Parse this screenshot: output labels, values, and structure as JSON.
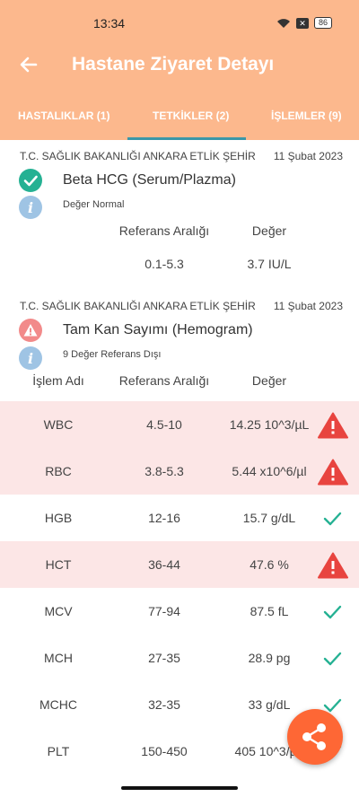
{
  "status_bar": {
    "time": "13:34",
    "battery": "86",
    "icons": [
      "wifi-icon",
      "x-box-icon",
      "battery-icon"
    ]
  },
  "app_bar": {
    "title": "Hastane Ziyaret Detayı",
    "back_icon": "arrow-left-icon"
  },
  "tabs": [
    {
      "label": "HASTALIKLAR (1)",
      "selected": false
    },
    {
      "label": "TETKİKLER (2)",
      "selected": true
    },
    {
      "label": "İŞLEMLER (9)",
      "selected": false
    }
  ],
  "colors": {
    "header": "#fcb88d",
    "ok": "#25b193",
    "warn": "#e8443f",
    "bad_row": "#fce6e6",
    "fab": "#fe6735",
    "info": "#9fc4e4",
    "tab_indicator": "#3b97a8"
  },
  "test1": {
    "hospital": "T.C. SAĞLIK BAKANLIĞI ANKARA ETLİK ŞEHİR",
    "date": "11 Şubat 2023",
    "name": "Beta HCG (Serum/Plazma)",
    "status_icon": "check-circle-icon",
    "note": "Değer Normal",
    "ref_header": "Referans Aralığı",
    "value_header": "Değer",
    "ref": "0.1-5.3",
    "value": "3.7 IU/L"
  },
  "test2": {
    "hospital": "T.C. SAĞLIK BAKANLIĞI ANKARA ETLİK ŞEHİR",
    "date": "11 Şubat 2023",
    "name": "Tam Kan Sayımı (Hemogram)",
    "status_icon": "warning-icon",
    "note": "9 Değer Referans Dışı",
    "headers": {
      "name": "İşlem Adı",
      "ref": "Referans Aralığı",
      "value": "Değer"
    },
    "rows": [
      {
        "name": "WBC",
        "ref": "4.5-10",
        "value": "14.25 10^3/µL",
        "status": "warning"
      },
      {
        "name": "RBC",
        "ref": "3.8-5.3",
        "value": "5.44 x10^6/µl",
        "status": "warning"
      },
      {
        "name": "HGB",
        "ref": "12-16",
        "value": "15.7 g/dL",
        "status": "ok"
      },
      {
        "name": "HCT",
        "ref": "36-44",
        "value": "47.6 %",
        "status": "warning"
      },
      {
        "name": "MCV",
        "ref": "77-94",
        "value": "87.5 fL",
        "status": "ok"
      },
      {
        "name": "MCH",
        "ref": "27-35",
        "value": "28.9 pg",
        "status": "ok"
      },
      {
        "name": "MCHC",
        "ref": "32-35",
        "value": "33 g/dL",
        "status": "ok"
      },
      {
        "name": "PLT",
        "ref": "150-450",
        "value": "405 10^3/µL",
        "status": "ok"
      }
    ]
  },
  "fab": {
    "icon": "share-icon"
  }
}
